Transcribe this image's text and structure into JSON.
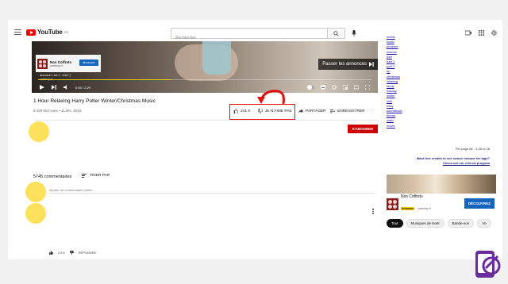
{
  "topbar": {
    "logo_text": "YouTube",
    "logo_sup": "FR",
    "search_placeholder": "Rechercher"
  },
  "player": {
    "ad_name": "Nos Coffrets",
    "ad_url": "watetrap.fr",
    "ad_cta": "découvrez",
    "ad_info": "Annonce 1 sur 2 · 0:24 ⓘ",
    "ad_url2": "watetrap.fr",
    "skip_label": "Passer les annonces",
    "time": "0:05 / 2:29",
    "progress": 0.4
  },
  "video": {
    "title": "1 Hour Relaxing Harry Potter Winter/Christmas Music",
    "views": "9 429 502 vues • 11 déc. 2018",
    "likes": "241 K",
    "dislike_label": "JE N'AIME PAS",
    "share_label": "PARTAGER",
    "save_label": "ENREGISTRER",
    "subscribe_label": "S'ABONNER"
  },
  "comments": {
    "count": "5745 commentaires",
    "sort_label": "TRIER PAR",
    "add_placeholder": "Ajouter un commentaire public...",
    "comment_likes": "2,8 k",
    "reply_label": "RÉPONDRE"
  },
  "sidebar": {
    "tags": [
      "obbits",
      "sodst",
      "phoeme",
      "sokose",
      "part",
      "part 1",
      "part 2",
      "hp",
      "christmas",
      "relaxing",
      "study",
      "holiday",
      "winter",
      "chill",
      "easy",
      "soundtrack",
      "theme",
      "main",
      "movie"
    ],
    "per_page": "Per page  All ·  1-28 of 28",
    "credits_line1": "Want free credits to see search volume for tags?",
    "credits_line2": "Check out our referral program",
    "ad_name": "Nos Coffrets",
    "ad_badge": "Annonce",
    "ad_url": "watetrap.fr",
    "ad_cta": "DÉCOUVREZ",
    "chips": [
      "Tout",
      "Musiques de Noël",
      "Bande-son",
      "Vo"
    ]
  },
  "colors": {
    "brand_red": "#ff0000",
    "subscribe_red": "#cc0000",
    "highlight_red": "#e11111",
    "marker_yellow": "#fde05c",
    "link_blue": "#1a0dab",
    "ad_blue": "#1565c0"
  }
}
